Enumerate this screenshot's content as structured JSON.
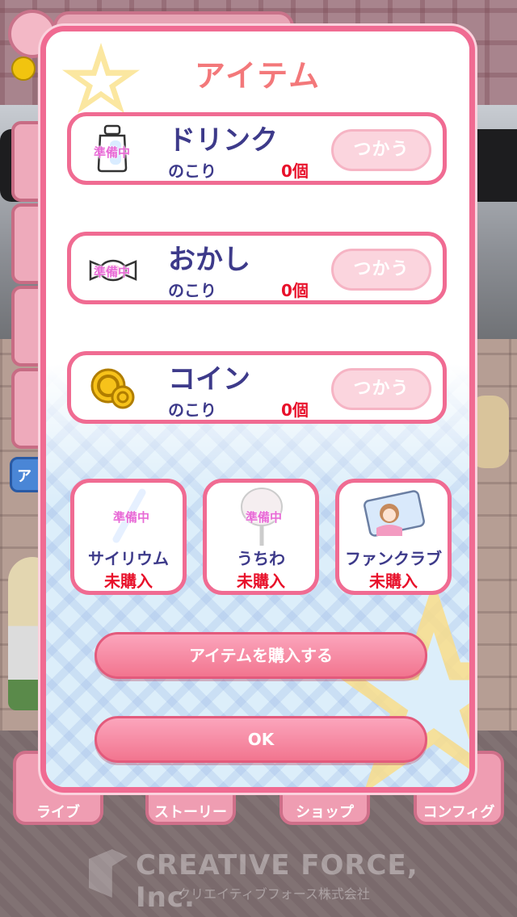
{
  "modal": {
    "title": "アイテム",
    "items": [
      {
        "name": "ドリンク",
        "remaining_label": "のこり",
        "count": "0個",
        "use_label": "つかう",
        "status": "準備中",
        "icon": "drink-bottle-icon"
      },
      {
        "name": "おかし",
        "remaining_label": "のこり",
        "count": "0個",
        "use_label": "つかう",
        "status": "準備中",
        "icon": "candy-icon"
      },
      {
        "name": "コイン",
        "remaining_label": "のこり",
        "count": "0個",
        "use_label": "つかう",
        "icon": "coin-icon"
      }
    ],
    "cheer_items": [
      {
        "name": "サイリウム",
        "status": "未購入",
        "overlay": "準備中",
        "icon": "glowstick-icon"
      },
      {
        "name": "うちわ",
        "status": "未購入",
        "overlay": "準備中",
        "icon": "fan-icon"
      },
      {
        "name": "ファンクラブ",
        "status": "未購入",
        "icon": "fanclub-card-icon"
      }
    ],
    "buy_label": "アイテムを購入する",
    "ok_label": "OK"
  },
  "background": {
    "side_tag": "ア",
    "nav": [
      "ライブ",
      "ストーリー",
      "ショップ",
      "コンフィグ"
    ],
    "company_name": "CREATIVE FORCE, Inc.",
    "company_sub": "クリエイティブフォース株式会社"
  },
  "colors": {
    "accent": "#f06b92",
    "text_navy": "#3d3a8a",
    "count_red": "#e8102a",
    "title_coral": "#f3787a"
  }
}
